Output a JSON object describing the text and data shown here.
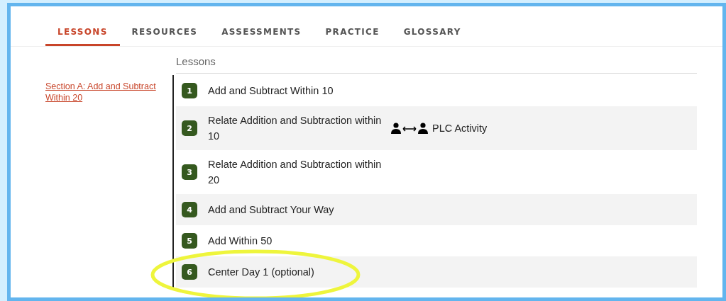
{
  "tabs": [
    {
      "label": "LESSONS",
      "selected": true
    },
    {
      "label": "RESOURCES",
      "selected": false
    },
    {
      "label": "ASSESSMENTS",
      "selected": false
    },
    {
      "label": "PRACTICE",
      "selected": false
    },
    {
      "label": "GLOSSARY",
      "selected": false
    }
  ],
  "lessons_header": "Lessons",
  "section": {
    "link": "Section A: Add and Subtract Within 20",
    "lessons": [
      {
        "number": "1",
        "title": "Add and Subtract Within 10"
      },
      {
        "number": "2",
        "title": "Relate Addition and Subtraction within 10",
        "activity": "PLC Activity"
      },
      {
        "number": "3",
        "title": "Relate Addition and Subtraction within 20"
      },
      {
        "number": "4",
        "title": "Add and Subtract Your Way"
      },
      {
        "number": "5",
        "title": "Add Within 50"
      },
      {
        "number": "6",
        "title": "Center Day 1 (optional)"
      }
    ]
  },
  "annotation": {
    "kind": "ellipse"
  }
}
